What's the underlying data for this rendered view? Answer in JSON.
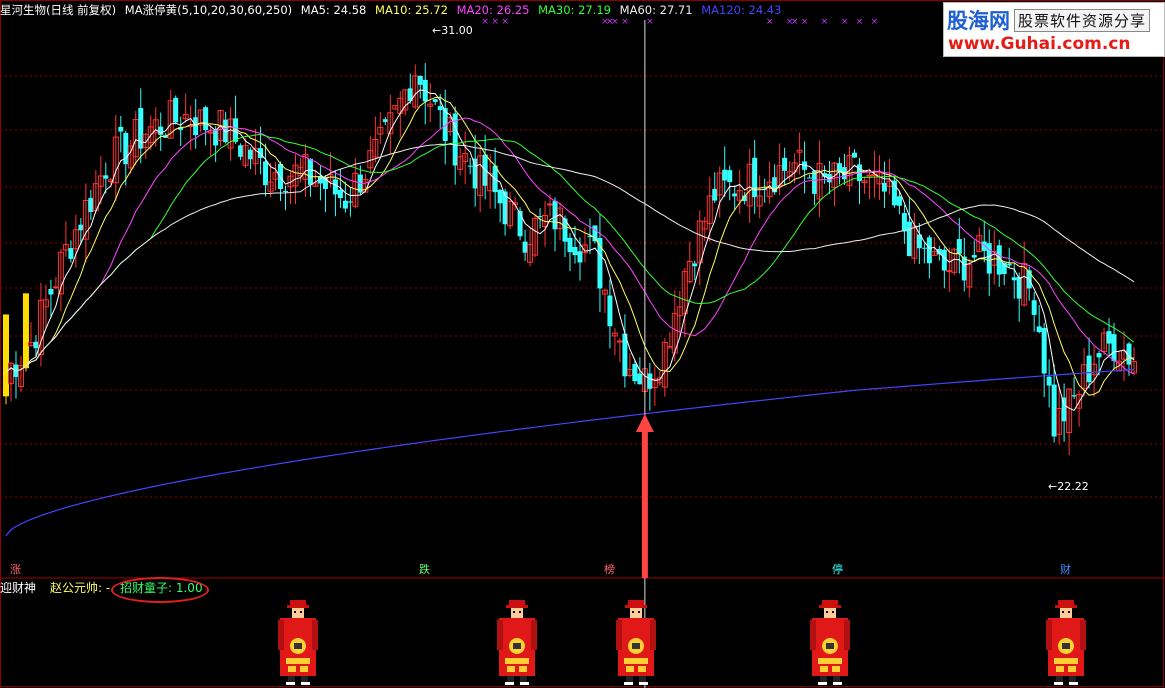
{
  "header": {
    "title": "星河生物(日线 前复权)",
    "indicator": "MA涨停黄(5,10,20,30,60,250)",
    "ma": [
      {
        "label": "MA5:",
        "value": "24.58",
        "color": "#ffffff"
      },
      {
        "label": "MA10:",
        "value": "25.72",
        "color": "#ffff66"
      },
      {
        "label": "MA20:",
        "value": "26.25",
        "color": "#ff44ff"
      },
      {
        "label": "MA30:",
        "value": "27.19",
        "color": "#33ff33"
      },
      {
        "label": "MA60:",
        "value": "27.71",
        "color": "#eeeeee"
      },
      {
        "label": "MA120:",
        "value": "24.43",
        "color": "#4444ff"
      }
    ]
  },
  "watermark": {
    "logo": "股海网",
    "slogan": "股票软件资源分享",
    "url": "www.Guhai.com.cn"
  },
  "annotations": {
    "high": "31.00",
    "low": "22.22"
  },
  "tags": [
    {
      "text": "涨",
      "color": "#ff6666"
    },
    {
      "text": "跌",
      "color": "#66ff66"
    },
    {
      "text": "榜",
      "color": "#ff6666"
    },
    {
      "text": "停",
      "color": "#33ffff"
    },
    {
      "text": "财",
      "color": "#4488ff"
    }
  ],
  "subpanel": {
    "label1": "迎财神",
    "label2": "赵公元帅: -",
    "label3": "招财童子: 1.00"
  },
  "colors": {
    "up": "#ff3333",
    "down": "#33ffff",
    "limit": "#ffdd00",
    "ma5": "#ffffff",
    "ma10": "#ffff66",
    "ma20": "#ff44ff",
    "ma30": "#33ff33",
    "ma60": "#eeeeee",
    "ma120": "#4444ff",
    "grid": "#8b0000",
    "arrow": "#ff4444"
  },
  "chart_data": {
    "type": "candlestick",
    "ylim": [
      20.5,
      31.6
    ],
    "high_annotation": 31.0,
    "low_annotation": 22.22,
    "close_keypoints": [
      [
        0,
        24.3
      ],
      [
        5,
        24.9
      ],
      [
        12,
        26.8
      ],
      [
        20,
        28.6
      ],
      [
        28,
        29.3
      ],
      [
        36,
        29.6
      ],
      [
        44,
        29.3
      ],
      [
        52,
        28.5
      ],
      [
        60,
        28.4
      ],
      [
        68,
        27.9
      ],
      [
        76,
        29.1
      ],
      [
        82,
        30.6
      ],
      [
        88,
        29.3
      ],
      [
        96,
        28.2
      ],
      [
        104,
        27.2
      ],
      [
        110,
        27.5
      ],
      [
        118,
        26.7
      ],
      [
        124,
        24.6
      ],
      [
        128,
        24.1
      ],
      [
        132,
        24.8
      ],
      [
        136,
        26.4
      ],
      [
        142,
        28.0
      ],
      [
        150,
        28.3
      ],
      [
        158,
        28.6
      ],
      [
        164,
        28.2
      ],
      [
        170,
        28.4
      ],
      [
        176,
        28.0
      ],
      [
        182,
        26.9
      ],
      [
        188,
        26.4
      ],
      [
        194,
        26.7
      ],
      [
        200,
        26.6
      ],
      [
        206,
        25.9
      ],
      [
        210,
        23.2
      ],
      [
        214,
        23.7
      ],
      [
        218,
        24.6
      ],
      [
        222,
        24.9
      ],
      [
        226,
        24.6
      ]
    ],
    "limit_up_days": [
      0,
      4
    ],
    "marker_days": [
      4,
      102,
      128,
      170,
      218
    ],
    "arrow_day": 128,
    "ma_end_values": {
      "MA5": 24.58,
      "MA10": 25.72,
      "MA20": 26.25,
      "MA30": 27.19,
      "MA60": 27.71,
      "MA120": 24.43
    },
    "sub_indicator": {
      "name": "招财童子",
      "value": 1.0
    }
  }
}
